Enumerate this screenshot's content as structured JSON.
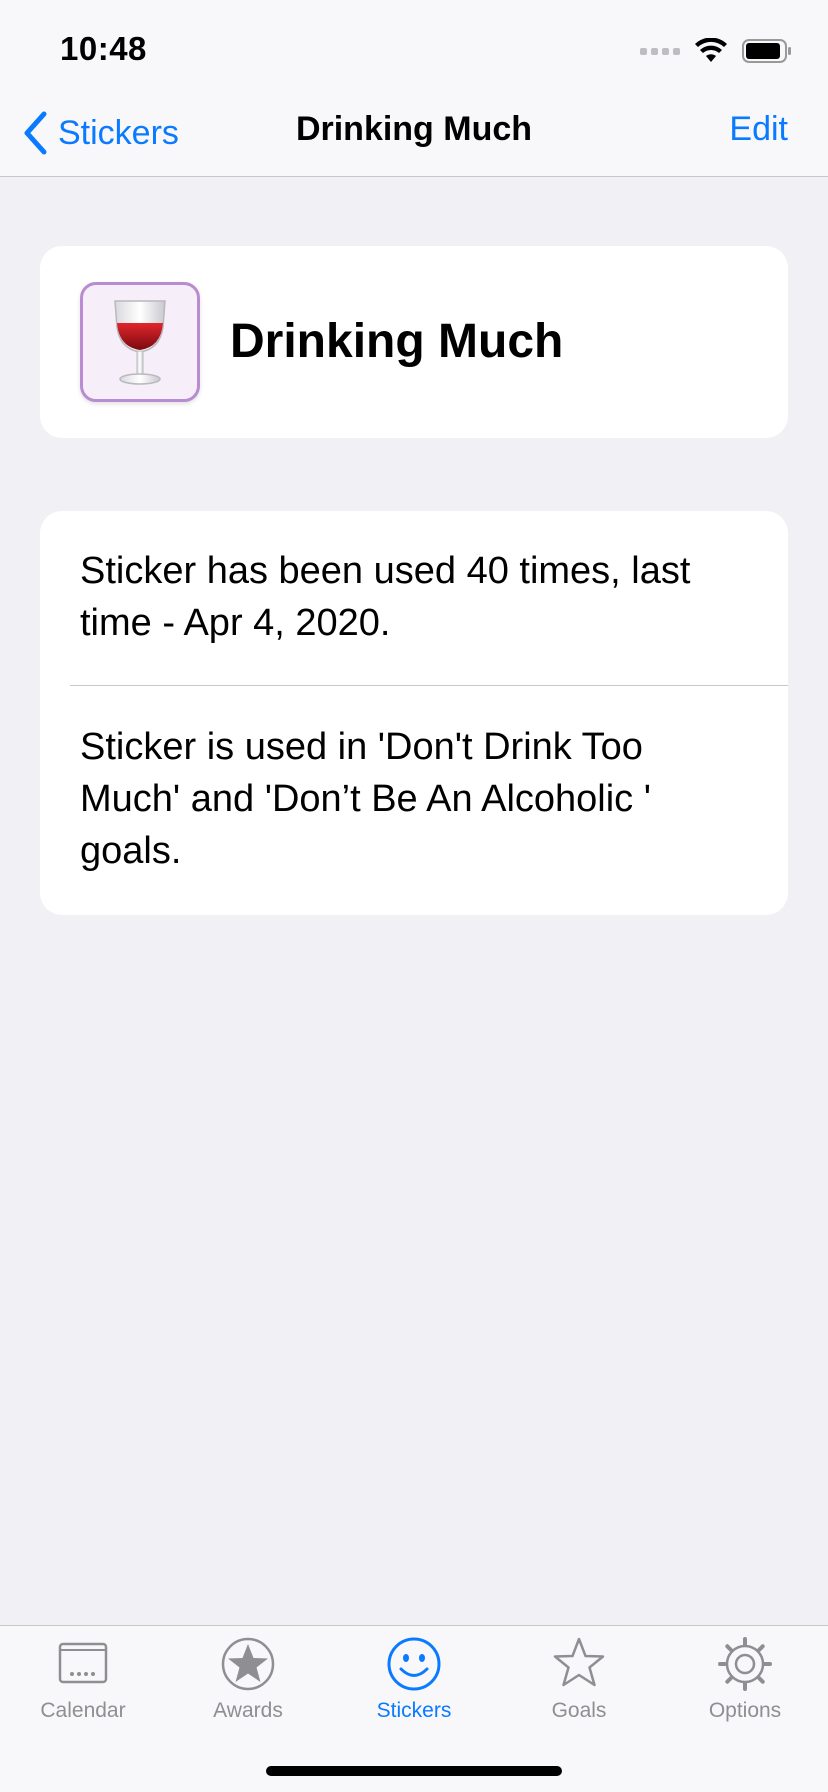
{
  "status_bar": {
    "time": "10:48"
  },
  "nav": {
    "back_label": "Stickers",
    "title": "Drinking Much",
    "edit_label": "Edit"
  },
  "sticker": {
    "name": "Drinking Much",
    "icon": "wine-glass-icon",
    "icon_border_color": "#b98bd0"
  },
  "info": {
    "usage_text": "Sticker has been used 40 times, last time - Apr 4, 2020.",
    "goals_text": "Sticker is used in 'Don't Drink Too Much' and 'Don’t Be An Alcoholic ' goals."
  },
  "tabs": [
    {
      "label": "Calendar",
      "icon": "calendar-icon",
      "active": false
    },
    {
      "label": "Awards",
      "icon": "award-star-icon",
      "active": false
    },
    {
      "label": "Stickers",
      "icon": "smiley-icon",
      "active": true
    },
    {
      "label": "Goals",
      "icon": "star-outline-icon",
      "active": false
    },
    {
      "label": "Options",
      "icon": "gear-icon",
      "active": false
    }
  ],
  "colors": {
    "accent": "#0a7aff",
    "inactive": "#8e8e93",
    "background": "#f0f0f5"
  }
}
